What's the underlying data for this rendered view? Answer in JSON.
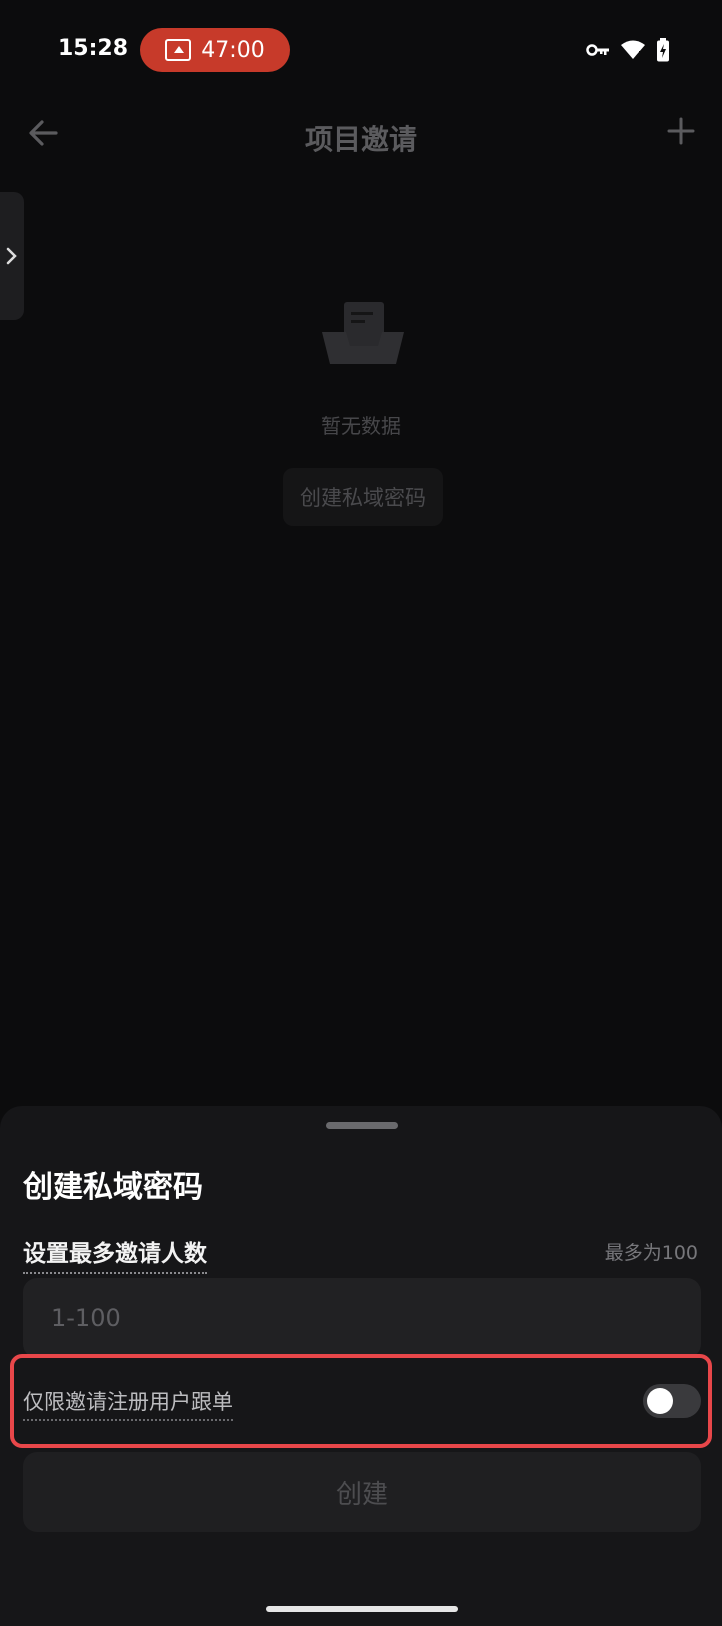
{
  "status_bar": {
    "time": "15:28",
    "recording_timer": "47:00",
    "icons": [
      "vpn-key-icon",
      "wifi-icon",
      "battery-charging-icon"
    ]
  },
  "header": {
    "title": "项目邀请",
    "back_icon": "arrow-left-icon",
    "add_icon": "plus-icon"
  },
  "empty_state": {
    "message": "暂无数据",
    "create_button_label": "创建私域密码"
  },
  "sheet": {
    "title": "创建私域密码",
    "max_invite_label": "设置最多邀请人数",
    "max_hint": "最多为100",
    "input_placeholder": "1-100",
    "input_value": "",
    "toggle_label": "仅限邀请注册用户跟单",
    "toggle_on": false,
    "submit_label": "创建"
  },
  "colors": {
    "accent_record": "#c73a2a",
    "highlight_border": "#e8474a",
    "sheet_bg": "#161618"
  }
}
